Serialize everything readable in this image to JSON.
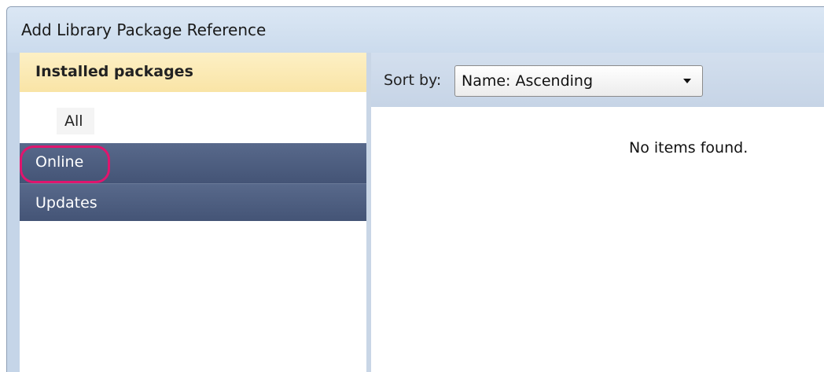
{
  "window": {
    "title": "Add Library Package Reference"
  },
  "sidebar": {
    "header": "Installed packages",
    "subitems": [
      {
        "label": "All"
      }
    ],
    "items": [
      {
        "label": "Online",
        "highlighted": true
      },
      {
        "label": "Updates"
      }
    ]
  },
  "main": {
    "sort_label": "Sort by:",
    "sort_value": "Name: Ascending",
    "empty_message": "No items found."
  },
  "colors": {
    "nav_item_bg": "#4b5b7e",
    "header_bg": "#fbe9b2",
    "annotation": "#e0156e"
  }
}
